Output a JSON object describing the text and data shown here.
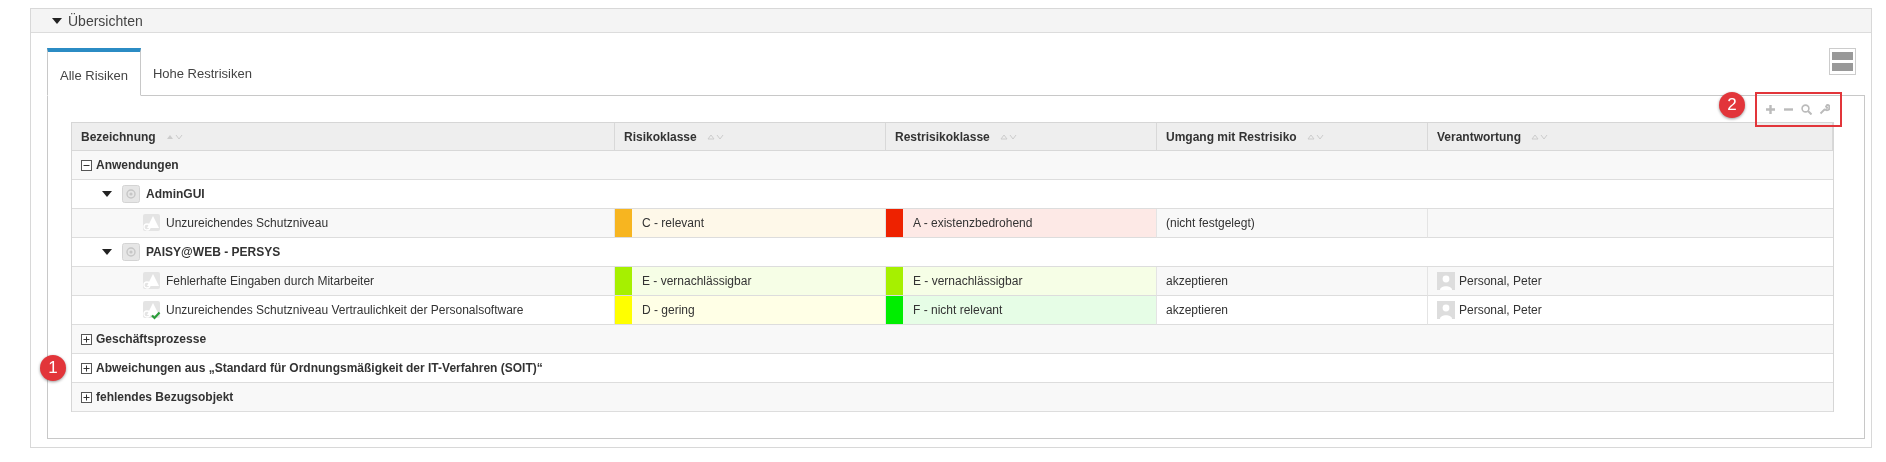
{
  "section": {
    "title": "Übersichten",
    "expanded": true
  },
  "tabs": [
    {
      "label": "Alle Risiken",
      "selected": true
    },
    {
      "label": "Hohe Restrisiken",
      "selected": false
    }
  ],
  "table": {
    "columns": [
      "Bezeichnung",
      "Risikoklasse",
      "Restrisikoklasse",
      "Umgang mit Restrisiko",
      "Verantwortung"
    ],
    "groups": [
      {
        "label": "Anwendungen",
        "expanded": true,
        "children": [
          {
            "label": "AdminGUI",
            "expanded": true,
            "risks": [
              {
                "name": "Unzureichendes Schutzniveau",
                "checked": false,
                "risk_class": {
                  "text": "C - relevant",
                  "color": "#f7b520"
                },
                "residual_class": {
                  "text": "A - existenzbedrohend",
                  "color": "#ee2200"
                },
                "handling": "(nicht festgelegt)"
              }
            ]
          },
          {
            "label": "PAISY@WEB - PERSYS",
            "expanded": true,
            "risks": [
              {
                "name": "Fehlerhafte Eingaben durch Mitarbeiter",
                "checked": false,
                "risk_class": {
                  "text": "E - vernachlässigbar",
                  "color": "#a6f000"
                },
                "residual_class": {
                  "text": "E - vernachlässigbar",
                  "color": "#a6f000"
                },
                "handling": "akzeptieren",
                "owner": "Personal, Peter"
              },
              {
                "name": "Unzureichendes Schutzniveau Vertraulichkeit der Personalsoftware",
                "checked": true,
                "risk_class": {
                  "text": "D - gering",
                  "color": "#ffff00"
                },
                "residual_class": {
                  "text": "F - nicht relevant",
                  "color": "#00ee00"
                },
                "handling": "akzeptieren",
                "owner": "Personal, Peter"
              }
            ]
          }
        ]
      },
      {
        "label": "Geschäftsprozesse",
        "expanded": false
      },
      {
        "label": "Abweichungen aus „Standard für Ordnungsmäßigkeit der IT-Verfahren (SOIT)“",
        "expanded": false
      },
      {
        "label": "fehlendes Bezugsobjekt",
        "expanded": false
      }
    ]
  },
  "callouts": [
    {
      "number": "1"
    },
    {
      "number": "2"
    }
  ]
}
